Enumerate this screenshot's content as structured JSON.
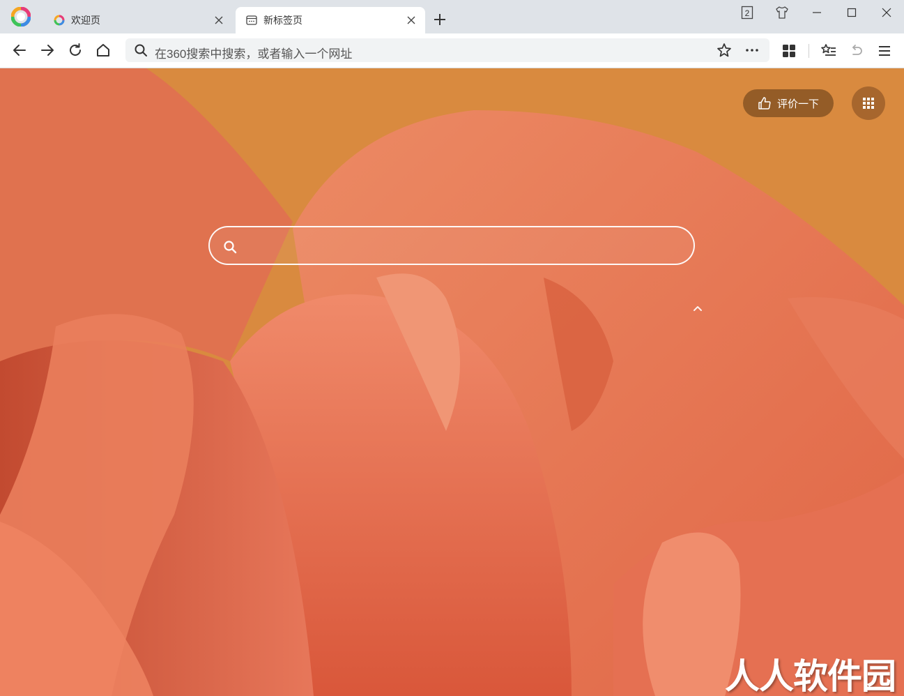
{
  "tabs": [
    {
      "title": "欢迎页",
      "icon": "360-browser-icon",
      "active": false
    },
    {
      "title": "新标签页",
      "icon": "new-tab-page-icon",
      "active": true
    }
  ],
  "window": {
    "tab_count_badge": "2"
  },
  "toolbar": {
    "omnibox_placeholder": "在360搜索中搜索，或者输入一个网址"
  },
  "newtab": {
    "rate_label": "评价一下",
    "search_placeholder": "",
    "watermark": "人人软件园"
  },
  "colors": {
    "tabstrip_bg": "#dfe3e8",
    "content_bg": "#d98a3f",
    "petal": "#e8785a"
  }
}
